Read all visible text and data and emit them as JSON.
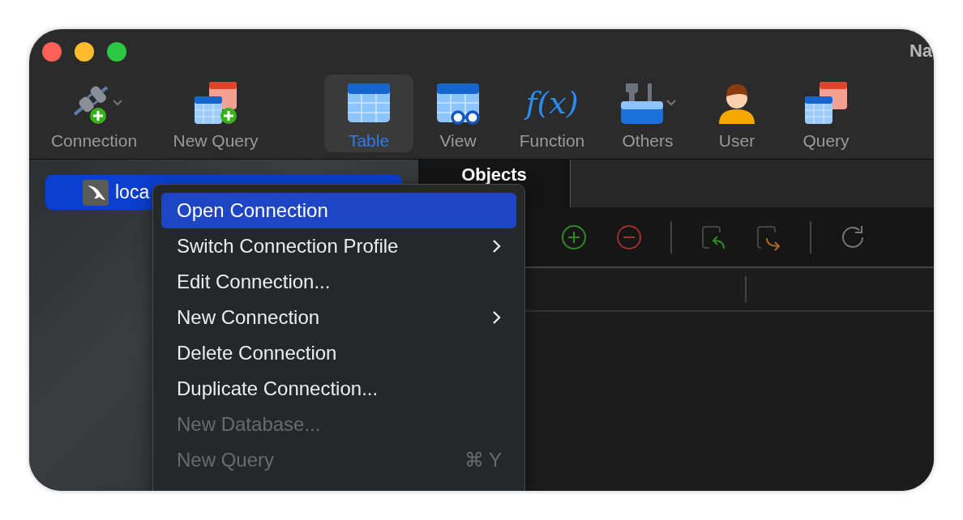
{
  "window": {
    "title": "Na"
  },
  "toolbar": [
    {
      "kind": "connection",
      "label": "Connection",
      "selected": false,
      "dropdown": true
    },
    {
      "kind": "new-query",
      "label": "New Query",
      "selected": false,
      "dropdown": false
    },
    {
      "kind": "table",
      "label": "Table",
      "selected": true,
      "dropdown": false
    },
    {
      "kind": "view",
      "label": "View",
      "selected": false,
      "dropdown": false
    },
    {
      "kind": "function",
      "label": "Function",
      "selected": false,
      "dropdown": false,
      "icon_text": "f(x)"
    },
    {
      "kind": "others",
      "label": "Others",
      "selected": false,
      "dropdown": true
    },
    {
      "kind": "user",
      "label": "User",
      "selected": false,
      "dropdown": false
    },
    {
      "kind": "query",
      "label": "Query",
      "selected": false,
      "dropdown": false
    }
  ],
  "sidebar": {
    "items": [
      {
        "label": "loca",
        "selected": true
      }
    ]
  },
  "tabs": [
    {
      "label": "Objects",
      "selected": true
    }
  ],
  "context_menu": {
    "items": [
      {
        "label": "Open Connection",
        "selected": true,
        "disabled": false,
        "submenu": false
      },
      {
        "label": "Switch Connection Profile",
        "selected": false,
        "disabled": false,
        "submenu": true
      },
      {
        "label": "Edit Connection...",
        "selected": false,
        "disabled": false,
        "submenu": false
      },
      {
        "label": "New Connection",
        "selected": false,
        "disabled": false,
        "submenu": true
      },
      {
        "label": "Delete Connection",
        "selected": false,
        "disabled": false,
        "submenu": false
      },
      {
        "label": "Duplicate Connection...",
        "selected": false,
        "disabled": false,
        "submenu": false
      },
      {
        "label": "New Database...",
        "selected": false,
        "disabled": true,
        "submenu": false
      },
      {
        "label": "New Query",
        "selected": false,
        "disabled": true,
        "submenu": false,
        "shortcut": "⌘ Y"
      }
    ]
  }
}
